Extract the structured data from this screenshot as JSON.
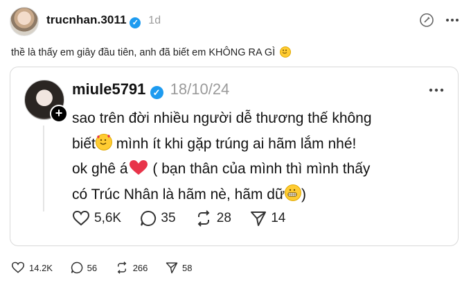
{
  "post": {
    "author": "trucnhan.3011",
    "time": "1d",
    "text": "thề là thấy em giây đầu tiên, anh đã biết em KHÔNG RA GÌ",
    "stats": {
      "likes": "14.2K",
      "replies": "56",
      "reposts": "266",
      "shares": "58"
    }
  },
  "quoted": {
    "author": "miule5791",
    "date": "18/10/24",
    "line1": "sao trên đời nhiều người dễ thương thế không",
    "line2a": "biết",
    "line2b": " mình ít khi gặp trúng ai hãm lắm nhé!",
    "line3a": "ok ghê á",
    "line3b": " ( bạn thân của mình thì mình thấy",
    "line4a": "có Trúc Nhân là hãm nè, hãm dữ",
    "line4b": ")",
    "stats": {
      "likes": "5,6K",
      "replies": "35",
      "reposts": "28",
      "shares": "14"
    }
  },
  "icons": {
    "verified": "verified-badge-icon",
    "like": "heart-icon",
    "reply": "comment-icon",
    "repost": "repost-icon",
    "share": "send-icon",
    "more": "more-dots-icon"
  },
  "colors": {
    "verified": "#1d9bf0",
    "timestamp": "#9a9a9a"
  }
}
